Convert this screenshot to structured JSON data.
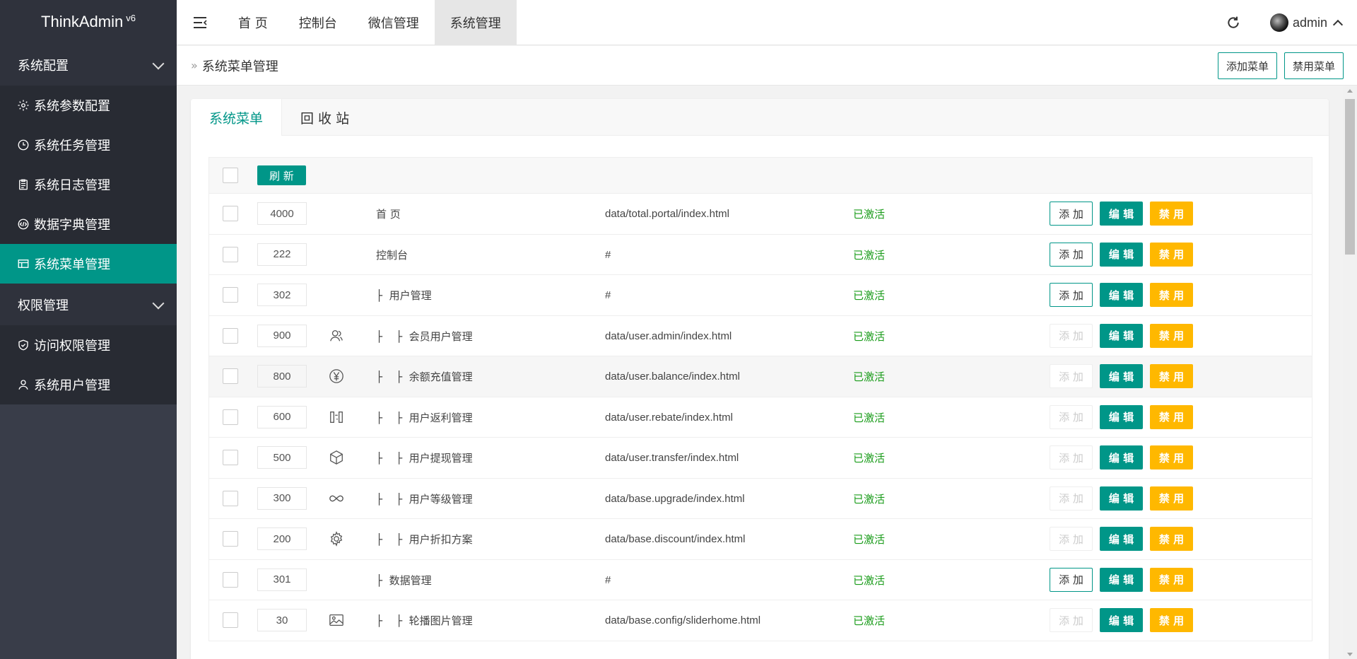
{
  "app": {
    "logo_text": "ThinkAdmin",
    "logo_version": "v6"
  },
  "sidebar": {
    "groups": [
      {
        "label": "系统配置",
        "items": [
          {
            "label": "系统参数配置",
            "icon": "gear-icon"
          },
          {
            "label": "系统任务管理",
            "icon": "clock-icon"
          },
          {
            "label": "系统日志管理",
            "icon": "clipboard-icon"
          },
          {
            "label": "数据字典管理",
            "icon": "code-icon"
          },
          {
            "label": "系统菜单管理",
            "icon": "table-icon",
            "active": true
          }
        ]
      },
      {
        "label": "权限管理",
        "items": [
          {
            "label": "访问权限管理",
            "icon": "shield-icon"
          },
          {
            "label": "系统用户管理",
            "icon": "user-icon"
          }
        ]
      }
    ]
  },
  "topnav": {
    "items": [
      "首 页",
      "控制台",
      "微信管理",
      "系统管理"
    ],
    "active_index": 3,
    "user_name": "admin"
  },
  "breadcrumb": {
    "title": "系统菜单管理",
    "add_menu_label": "添加菜单",
    "disable_menu_label": "禁用菜单"
  },
  "tabs": [
    "系统菜单",
    "回 收 站"
  ],
  "table": {
    "refresh_label": "刷 新",
    "add_label": "添 加",
    "edit_label": "编 辑",
    "disable_label": "禁 用",
    "rows": [
      {
        "sort": "4000",
        "title": "首 页",
        "url": "data/total.portal/index.html",
        "status": "已激活",
        "icon": "",
        "add_enabled": true
      },
      {
        "sort": "222",
        "title": "控制台",
        "url": "#",
        "status": "已激活",
        "icon": "",
        "add_enabled": true
      },
      {
        "sort": "302",
        "title": "├  用户管理",
        "url": "#",
        "status": "已激活",
        "icon": "",
        "add_enabled": true
      },
      {
        "sort": "900",
        "title": "├    ├  会员用户管理",
        "url": "data/user.admin/index.html",
        "status": "已激活",
        "icon": "users-icon",
        "add_enabled": false
      },
      {
        "sort": "800",
        "title": "├    ├  余额充值管理",
        "url": "data/user.balance/index.html",
        "status": "已激活",
        "icon": "yen-icon",
        "add_enabled": false
      },
      {
        "sort": "600",
        "title": "├    ├  用户返利管理",
        "url": "data/user.rebate/index.html",
        "status": "已激活",
        "icon": "transfer-icon",
        "add_enabled": false
      },
      {
        "sort": "500",
        "title": "├    ├  用户提现管理",
        "url": "data/user.transfer/index.html",
        "status": "已激活",
        "icon": "cube-icon",
        "add_enabled": false
      },
      {
        "sort": "300",
        "title": "├    ├  用户等级管理",
        "url": "data/base.upgrade/index.html",
        "status": "已激活",
        "icon": "infinity-icon",
        "add_enabled": false
      },
      {
        "sort": "200",
        "title": "├    ├  用户折扣方案",
        "url": "data/base.discount/index.html",
        "status": "已激活",
        "icon": "gear-icon",
        "add_enabled": false
      },
      {
        "sort": "301",
        "title": "├  数据管理",
        "url": "#",
        "status": "已激活",
        "icon": "",
        "add_enabled": true
      },
      {
        "sort": "30",
        "title": "├    ├  轮播图片管理",
        "url": "data/base.config/sliderhome.html",
        "status": "已激活",
        "icon": "image-icon",
        "add_enabled": false
      }
    ]
  },
  "colors": {
    "accent": "#009688",
    "warn": "#FFB800",
    "sidebar_bg": "#393D49",
    "status_active": "#1a9c1a"
  }
}
